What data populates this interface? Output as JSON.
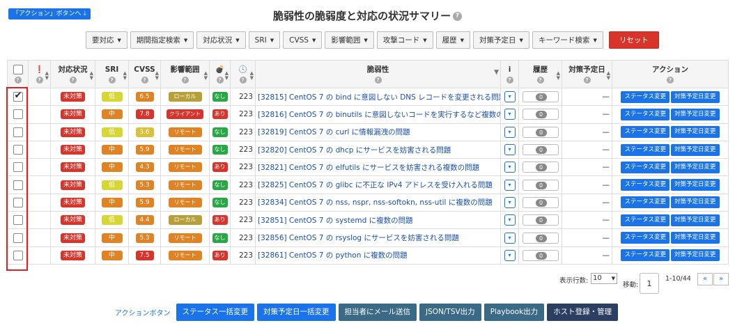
{
  "top_link": "「アクション」ボタンへ",
  "page_title": "脆弱性の脆弱度と対応の状況サマリー",
  "filters": [
    "要対応",
    "期間指定検索",
    "対応状況",
    "SRI",
    "CVSS",
    "影響範囲",
    "攻撃コード",
    "履歴",
    "対策予定日",
    "キーワード検索"
  ],
  "reset_label": "リセット",
  "headers": {
    "status": "対応状況",
    "sri": "SRI",
    "cvss": "CVSS",
    "scope": "影響範囲",
    "vuln": "脆弱性",
    "info": "i",
    "history": "履歴",
    "plan": "対策予定日",
    "action": "アクション"
  },
  "rows": [
    {
      "checked": true,
      "status": "未対策",
      "sri": "低",
      "sri_level": "low",
      "cvss": "6.5",
      "cvss_level": "mid",
      "scope": "ローカル",
      "scope_kind": "local",
      "attack": "なし",
      "attack_kind": "none",
      "days": "223",
      "vuln": "[32815] CentOS 7 の bind に意図しない DNS レコードを変更される問題",
      "hist": "0",
      "plan": "—"
    },
    {
      "checked": false,
      "status": "未対策",
      "sri": "中",
      "sri_level": "mid",
      "cvss": "7.8",
      "cvss_level": "high",
      "scope": "クライアント",
      "scope_kind": "client",
      "attack": "あり",
      "attack_kind": "yes",
      "days": "223",
      "vuln": "[32816] CentOS 7 の binutils に意図しないコードを実行するなど複数の...",
      "hist": "0",
      "plan": "—"
    },
    {
      "checked": false,
      "status": "未対策",
      "sri": "低",
      "sri_level": "low",
      "cvss": "3.6",
      "cvss_level": "low",
      "scope": "リモート",
      "scope_kind": "remote",
      "attack": "なし",
      "attack_kind": "none",
      "days": "223",
      "vuln": "[32819] CentOS 7 の curl に情報漏洩の問題",
      "hist": "0",
      "plan": "—"
    },
    {
      "checked": false,
      "status": "未対策",
      "sri": "中",
      "sri_level": "mid",
      "cvss": "5.9",
      "cvss_level": "mid",
      "scope": "リモート",
      "scope_kind": "remote",
      "attack": "なし",
      "attack_kind": "none",
      "days": "223",
      "vuln": "[32820] CentOS 7 の dhcp にサービスを妨害される問題",
      "hist": "0",
      "plan": "—"
    },
    {
      "checked": false,
      "status": "未対策",
      "sri": "中",
      "sri_level": "mid",
      "cvss": "4.3",
      "cvss_level": "mid",
      "scope": "リモート",
      "scope_kind": "remote",
      "attack": "あり",
      "attack_kind": "yes",
      "days": "223",
      "vuln": "[32821] CentOS 7 の elfutils にサービスを妨害される複数の問題",
      "hist": "0",
      "plan": "—"
    },
    {
      "checked": false,
      "status": "未対策",
      "sri": "低",
      "sri_level": "low",
      "cvss": "5.3",
      "cvss_level": "mid",
      "scope": "リモート",
      "scope_kind": "remote",
      "attack": "なし",
      "attack_kind": "none",
      "days": "223",
      "vuln": "[32825] CentOS 7 の glibc に不正な IPv4 アドレスを受け入れる問題",
      "hist": "0",
      "plan": "—"
    },
    {
      "checked": false,
      "status": "未対策",
      "sri": "中",
      "sri_level": "mid",
      "cvss": "5.9",
      "cvss_level": "mid",
      "scope": "リモート",
      "scope_kind": "remote",
      "attack": "なし",
      "attack_kind": "none",
      "days": "223",
      "vuln": "[32834] CentOS 7 の nss, nspr, nss-softokn, nss-util に複数の問題",
      "hist": "0",
      "plan": "—"
    },
    {
      "checked": false,
      "status": "未対策",
      "sri": "低",
      "sri_level": "low",
      "cvss": "4.4",
      "cvss_level": "mid",
      "scope": "ローカル",
      "scope_kind": "local",
      "attack": "あり",
      "attack_kind": "yes",
      "days": "223",
      "vuln": "[32851] CentOS 7 の systemd に複数の問題",
      "hist": "0",
      "plan": "—"
    },
    {
      "checked": false,
      "status": "未対策",
      "sri": "中",
      "sri_level": "mid",
      "cvss": "5.3",
      "cvss_level": "mid",
      "scope": "リモート",
      "scope_kind": "remote",
      "attack": "なし",
      "attack_kind": "none",
      "days": "223",
      "vuln": "[32856] CentOS 7 の rsyslog にサービスを妨害される問題",
      "hist": "0",
      "plan": "—"
    },
    {
      "checked": false,
      "status": "未対策",
      "sri": "中",
      "sri_level": "mid",
      "cvss": "7.5",
      "cvss_level": "high",
      "scope": "リモート",
      "scope_kind": "remote",
      "attack": "あり",
      "attack_kind": "yes",
      "days": "223",
      "vuln": "[32861] CentOS 7 の python に複数の問題",
      "hist": "0",
      "plan": "—"
    }
  ],
  "row_actions": {
    "status_change": "ステータス変更",
    "plan_change": "対策予定日変更"
  },
  "pager": {
    "rows_label": "表示行数:",
    "rows_value": "10",
    "move_label": "移動:",
    "page": "1",
    "range": "1-10/44",
    "prev": "«",
    "next": "»"
  },
  "bottom": {
    "label": "アクションボタン",
    "buttons": [
      "ステータス一括変更",
      "対策予定日一括変更",
      "担当者にメール送信",
      "JSON/TSV出力",
      "Playbook出力",
      "ホスト登録・管理"
    ]
  }
}
